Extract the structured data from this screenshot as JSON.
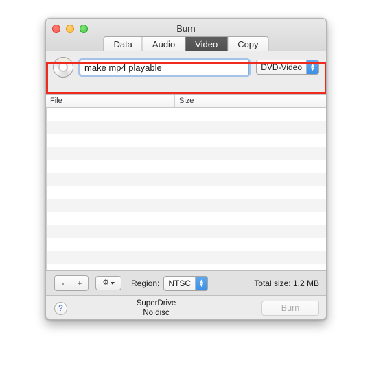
{
  "window": {
    "title": "Burn",
    "traffic_lights": [
      "close",
      "minimize",
      "zoom"
    ]
  },
  "tabs": [
    {
      "label": "Data",
      "active": false
    },
    {
      "label": "Audio",
      "active": false
    },
    {
      "label": "Video",
      "active": true
    },
    {
      "label": "Copy",
      "active": false
    }
  ],
  "source": {
    "disc_icon": "disc-icon",
    "name_value": "make mp4 playable",
    "name_placeholder": "Disc name",
    "format_selected": "DVD-Video"
  },
  "list": {
    "columns": [
      "File",
      "Size"
    ],
    "rows": []
  },
  "options": {
    "remove_label": "-",
    "add_label": "+",
    "gear_label": "gear-icon",
    "region_label": "Region:",
    "region_selected": "NTSC",
    "total_size": "Total size: 1.2 MB"
  },
  "status": {
    "help_label": "?",
    "drive_name": "SuperDrive",
    "disc_state": "No disc",
    "burn_label": "Burn"
  },
  "annotation": {
    "color": "#ef2b20",
    "target": "disc-name-and-format-row"
  }
}
